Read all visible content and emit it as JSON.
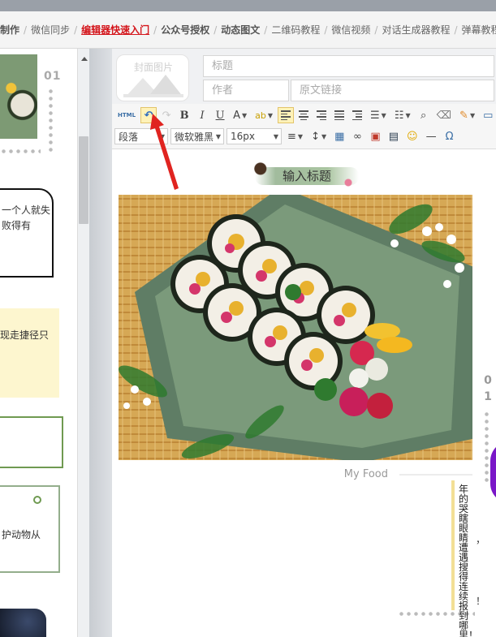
{
  "nav": {
    "items": [
      {
        "label": "制作",
        "bold": true
      },
      {
        "label": "微信同步",
        "bold": false
      },
      {
        "label": "编辑器快速入门",
        "bold": false,
        "active": true
      },
      {
        "label": "公众号授权",
        "bold": true
      },
      {
        "label": "动态图文",
        "bold": true
      },
      {
        "label": "二维码教程",
        "bold": false
      },
      {
        "label": "微信视频",
        "bold": false
      },
      {
        "label": "对话生成器教程",
        "bold": false
      },
      {
        "label": "弹幕教程",
        "bold": false
      }
    ]
  },
  "left_panel": {
    "number": "01",
    "card_black_text": "一个人就失败得有",
    "card_yellow_text": "现走捷径只",
    "card_tag_text": "护动物从"
  },
  "editor": {
    "cover_label": "封面图片",
    "title_placeholder": "标题",
    "author_placeholder": "作者",
    "link_placeholder": "原文链接",
    "toolbar": {
      "html_label": "HTML",
      "bold": "B",
      "italic": "I",
      "underline": "U",
      "font_color": "A",
      "paragraph_format": "段落",
      "font_family": "微软雅黑",
      "font_size": "16px",
      "omega": "Ω",
      "hr": "—"
    },
    "content": {
      "title": "输入标题",
      "caption": "My Food",
      "number": [
        "0",
        "1"
      ],
      "vertical_text": "年的哭瞎眼睛遭遇搜得连续报到哪里！",
      "punct1": "，",
      "punct2": "！"
    }
  },
  "colors": {
    "accent_red": "#d4161c",
    "brush_green": "#91b08c",
    "yellow_bg": "#fdf6cf"
  }
}
